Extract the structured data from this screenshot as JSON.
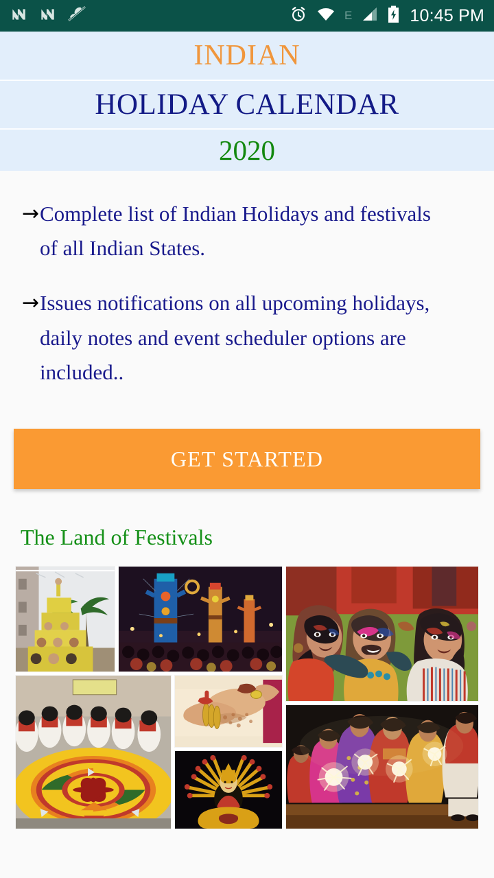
{
  "status_bar": {
    "background_color": "#0b5248",
    "left_icons": [
      {
        "name": "notification-n-icon-1",
        "label": "N"
      },
      {
        "name": "notification-n-icon-2",
        "label": "N"
      },
      {
        "name": "silent-mode-icon",
        "label": "silent"
      }
    ],
    "right_icons": [
      {
        "name": "alarm-icon",
        "label": "alarm"
      },
      {
        "name": "wifi-icon",
        "label": "wifi"
      }
    ],
    "network_type": "E",
    "signal_icon": "signal-bars-icon",
    "battery_icon": "battery-charging-icon",
    "time": "10:45 PM"
  },
  "header": {
    "line1": "INDIAN",
    "line2": "HOLIDAY CALENDAR",
    "line3": "2020",
    "line1_color": "#f0963c",
    "line2_color": "#131a86",
    "line3_color": "#13880f",
    "band_color": "#e2eefb"
  },
  "features": {
    "arrow_glyph": "→",
    "items": [
      "Complete list of Indian Holidays and festivals of all Indian States.",
      "Issues notifications on all upcoming holidays, daily notes and event scheduler options are included.."
    ]
  },
  "cta": {
    "label": "GET STARTED",
    "background_color": "#fa9a33",
    "text_color": "#fffdf7"
  },
  "gallery": {
    "title": "The Land of Festivals",
    "title_color": "#159018",
    "photos": [
      {
        "name": "photo-dahi-handi",
        "caption": "Dahi Handi human pyramid"
      },
      {
        "name": "photo-dussehra",
        "caption": "Dussehra Ravana effigies"
      },
      {
        "name": "photo-holi",
        "caption": "Children playing Holi"
      },
      {
        "name": "photo-onam-pookalam",
        "caption": "Onam flower rangoli"
      },
      {
        "name": "photo-raksha-bandhan",
        "caption": "Rakhi tied on hands with mehendi"
      },
      {
        "name": "photo-durga-idol",
        "caption": "Durga Puja idol"
      },
      {
        "name": "photo-diwali",
        "caption": "Diwali sparklers celebration"
      }
    ]
  }
}
